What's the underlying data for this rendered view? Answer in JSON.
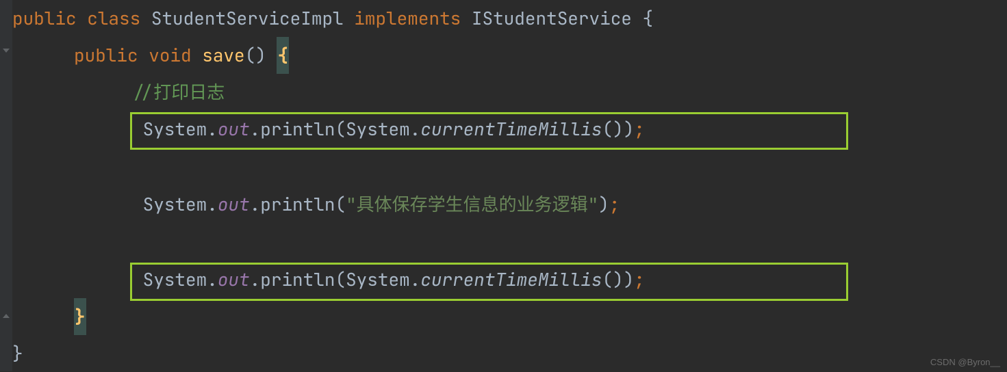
{
  "code": {
    "line1": {
      "kw1": "public",
      "kw2": "class",
      "className": "StudentServiceImpl",
      "kw3": "implements",
      "interfaceName": "IStudentService",
      "brace": "{"
    },
    "line2": {
      "kw1": "public",
      "kw2": "void",
      "methodName": "save",
      "parens": "()",
      "brace": "{"
    },
    "line3": {
      "comment": "//打印日志"
    },
    "line4": {
      "system": "System",
      "dot1": ".",
      "out": "out",
      "dot2": ".",
      "println": "println",
      "open": "(",
      "system2": "System",
      "dot3": ".",
      "method": "currentTimeMillis",
      "parens": "()",
      "close": ")",
      "semi": ";"
    },
    "line5": {
      "system": "System",
      "dot1": ".",
      "out": "out",
      "dot2": ".",
      "println": "println",
      "open": "(",
      "str": "\"具体保存学生信息的业务逻辑\"",
      "close": ")",
      "semi": ";"
    },
    "line6": {
      "system": "System",
      "dot1": ".",
      "out": "out",
      "dot2": ".",
      "println": "println",
      "open": "(",
      "system2": "System",
      "dot3": ".",
      "method": "currentTimeMillis",
      "parens": "()",
      "close": ")",
      "semi": ";"
    },
    "line7": {
      "brace": "}"
    },
    "line8": {
      "brace": "}"
    }
  },
  "watermark": "CSDN @Byron__"
}
